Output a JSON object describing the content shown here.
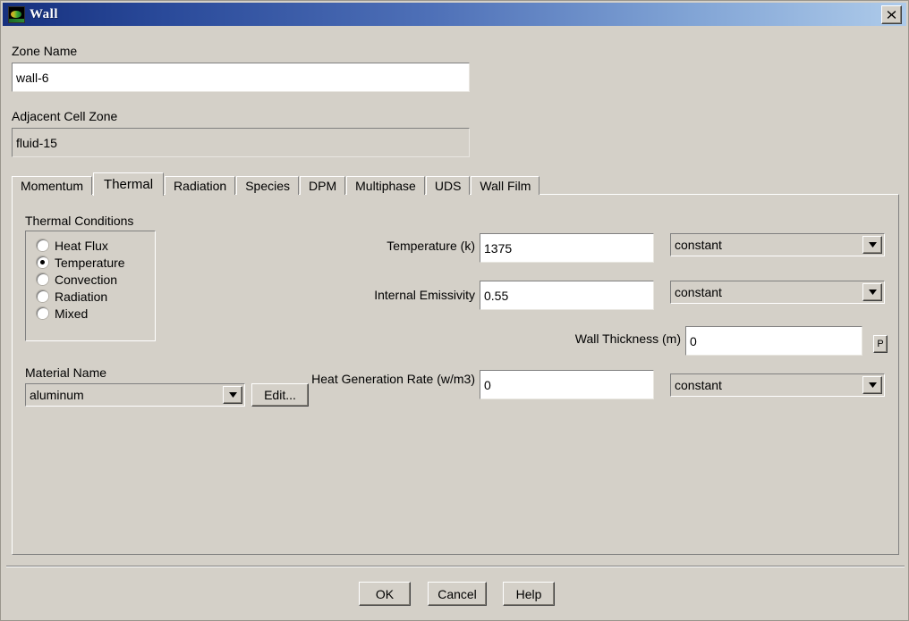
{
  "window": {
    "title": "Wall",
    "icon": "fluent-wall-icon",
    "close_label": "✕"
  },
  "zone": {
    "name_label": "Zone Name",
    "name_value": "wall-6",
    "adjacent_label": "Adjacent Cell Zone",
    "adjacent_value": "fluid-15"
  },
  "tabs": [
    {
      "label": "Momentum",
      "active": false
    },
    {
      "label": "Thermal",
      "active": true
    },
    {
      "label": "Radiation",
      "active": false
    },
    {
      "label": "Species",
      "active": false
    },
    {
      "label": "DPM",
      "active": false
    },
    {
      "label": "Multiphase",
      "active": false
    },
    {
      "label": "UDS",
      "active": false
    },
    {
      "label": "Wall Film",
      "active": false
    }
  ],
  "thermal": {
    "conditions_label": "Thermal Conditions",
    "conditions": [
      {
        "label": "Heat Flux",
        "selected": false
      },
      {
        "label": "Temperature",
        "selected": true
      },
      {
        "label": "Convection",
        "selected": false
      },
      {
        "label": "Radiation",
        "selected": false
      },
      {
        "label": "Mixed",
        "selected": false
      }
    ],
    "temperature": {
      "label": "Temperature (k)",
      "value": "1375",
      "method": "constant"
    },
    "emissivity": {
      "label": "Internal Emissivity",
      "value": "0.55",
      "method": "constant"
    },
    "wall_thickness": {
      "label": "Wall Thickness (m)",
      "value": "0",
      "profile_button": "P"
    },
    "heat_generation": {
      "label": "Heat Generation Rate (w/m3)",
      "value": "0",
      "method": "constant"
    },
    "material": {
      "label": "Material Name",
      "value": "aluminum",
      "edit_button": "Edit..."
    }
  },
  "footer": {
    "ok": "OK",
    "cancel": "Cancel",
    "help": "Help"
  }
}
